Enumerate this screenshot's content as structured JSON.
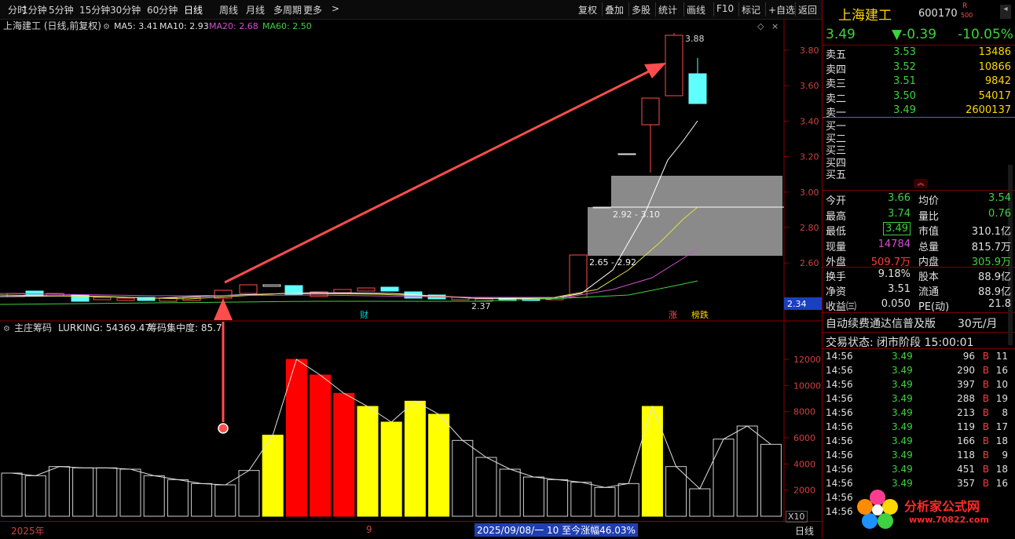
{
  "toolbar": {
    "left_items": [
      "分时",
      "1分钟",
      "5分钟",
      "15分钟",
      "30分钟",
      "60分钟",
      "日线",
      "周线",
      "月线",
      "多周期",
      "更多"
    ],
    "right_items": [
      "复权",
      "叠加",
      "多股",
      "统计",
      "画线",
      "F10",
      "标记",
      "+自选",
      "返回"
    ]
  },
  "main_chart": {
    "title": "上海建工 (日线,前复权)",
    "ma": [
      {
        "label": "MA5: 3.41",
        "color": "#e0e0e0"
      },
      {
        "label": "MA10: 2.93",
        "color": "#e0e0e0"
      },
      {
        "label": "MA20: 2.68",
        "color": "#d050d0"
      },
      {
        "label": "MA60: 2.50",
        "color": "#3fd13f"
      }
    ],
    "y_ticks": [
      "3.80",
      "3.60",
      "3.40",
      "3.20",
      "3.00",
      "2.80",
      "2.60"
    ],
    "current_price_tag": "2.34",
    "high_label": "3.88",
    "low_label": "2.37",
    "zone_label_1": "2.92 - 3.10",
    "zone_label_2": "2.65 - 2.92",
    "marker_cai": "财",
    "marker_zhang": "涨",
    "marker_bang": "榜跌"
  },
  "indicator": {
    "title": "主庄筹码",
    "lurking": "LURKING: 54369.47",
    "concentration": "筹码集中度: 85.7",
    "y_ticks": [
      "12000",
      "10000",
      "8000",
      "6000",
      "4000",
      "2000"
    ],
    "bar_values": [
      3300,
      3100,
      3800,
      3700,
      3700,
      3600,
      3100,
      2800,
      2500,
      2400,
      3500,
      6200,
      12000,
      10800,
      9400,
      8400,
      7200,
      8800,
      7800,
      5800,
      4500,
      3600,
      3000,
      2800,
      2600,
      2200,
      2500,
      8400,
      3800,
      2100,
      5900,
      6900,
      5500
    ],
    "bar_colors": [
      "k",
      "k",
      "k",
      "k",
      "k",
      "k",
      "k",
      "k",
      "k",
      "k",
      "k",
      "y",
      "r",
      "r",
      "r",
      "y",
      "y",
      "y",
      "y",
      "k",
      "k",
      "k",
      "k",
      "k",
      "k",
      "k",
      "k",
      "y",
      "k",
      "k",
      "k",
      "k",
      "k"
    ]
  },
  "bottom": {
    "year": "2025年",
    "month": "9",
    "range_text": "2025/09/08/一 10 至今涨幅46.03%",
    "scale": "X10",
    "period": "日线"
  },
  "quote": {
    "name": "上海建工",
    "code": "600170",
    "badge_r": "R",
    "badge_500": "500",
    "price": "3.49",
    "change": "▼-0.39",
    "change_pct": "-10.05%",
    "asks": [
      {
        "label": "卖五",
        "price": "3.53",
        "vol": "13486"
      },
      {
        "label": "卖四",
        "price": "3.52",
        "vol": "10866"
      },
      {
        "label": "卖三",
        "price": "3.51",
        "vol": "9842"
      },
      {
        "label": "卖二",
        "price": "3.50",
        "vol": "54017"
      },
      {
        "label": "卖一",
        "price": "3.49",
        "vol": "2600137"
      }
    ],
    "bids": [
      "买一",
      "买二",
      "买三",
      "买四",
      "买五"
    ],
    "stats": [
      {
        "l1": "今开",
        "v1": "3.66",
        "c1": "g",
        "l2": "均价",
        "v2": "3.54",
        "c2": "g"
      },
      {
        "l1": "最高",
        "v1": "3.74",
        "c1": "g",
        "l2": "量比",
        "v2": "0.76",
        "c2": "g"
      },
      {
        "l1": "最低",
        "v1": "3.49",
        "c1": "g",
        "l2": "市值",
        "v2": "310.1亿",
        "c2": "w"
      },
      {
        "l1": "现量",
        "v1": "14784",
        "c1": "m",
        "l2": "总量",
        "v2": "815.7万",
        "c2": "w"
      },
      {
        "l1": "外盘",
        "v1": "509.7万",
        "c1": "r",
        "l2": "内盘",
        "v2": "305.9万",
        "c2": "g"
      }
    ],
    "stats2": [
      {
        "l1": "换手",
        "v1": "9.18%",
        "l2": "股本",
        "v2": "88.9亿"
      },
      {
        "l1": "净资",
        "v1": "3.51",
        "l2": "流通",
        "v2": "88.9亿"
      },
      {
        "l1": "收益㈢",
        "v1": "0.050",
        "l2": "PE(动)",
        "v2": "21.8"
      }
    ],
    "ad_text": "自动续费通达信普及版",
    "ad_price": "30元/月",
    "trade_status": "交易状态: 闭市阶段 15:00:01",
    "ticks": [
      {
        "t": "14:56",
        "p": "3.49",
        "v": "96",
        "s": "B",
        "n": "11"
      },
      {
        "t": "14:56",
        "p": "3.49",
        "v": "290",
        "s": "B",
        "n": "16"
      },
      {
        "t": "14:56",
        "p": "3.49",
        "v": "397",
        "s": "B",
        "n": "10"
      },
      {
        "t": "14:56",
        "p": "3.49",
        "v": "288",
        "s": "B",
        "n": "19"
      },
      {
        "t": "14:56",
        "p": "3.49",
        "v": "213",
        "s": "B",
        "n": "8"
      },
      {
        "t": "14:56",
        "p": "3.49",
        "v": "119",
        "s": "B",
        "n": "17"
      },
      {
        "t": "14:56",
        "p": "3.49",
        "v": "166",
        "s": "B",
        "n": "18"
      },
      {
        "t": "14:56",
        "p": "3.49",
        "v": "118",
        "s": "B",
        "n": "9"
      },
      {
        "t": "14:56",
        "p": "3.49",
        "v": "451",
        "s": "B",
        "n": "18"
      },
      {
        "t": "14:56",
        "p": "3.49",
        "v": "357",
        "s": "B",
        "n": "16"
      },
      {
        "t": "14:56",
        "p": "",
        "v": "",
        "s": "",
        "n": ""
      },
      {
        "t": "14:56",
        "p": "",
        "v": "",
        "s": "",
        "n": ""
      }
    ],
    "watermark": "分析家公式网",
    "watermark_url": "www.70822.com"
  }
}
